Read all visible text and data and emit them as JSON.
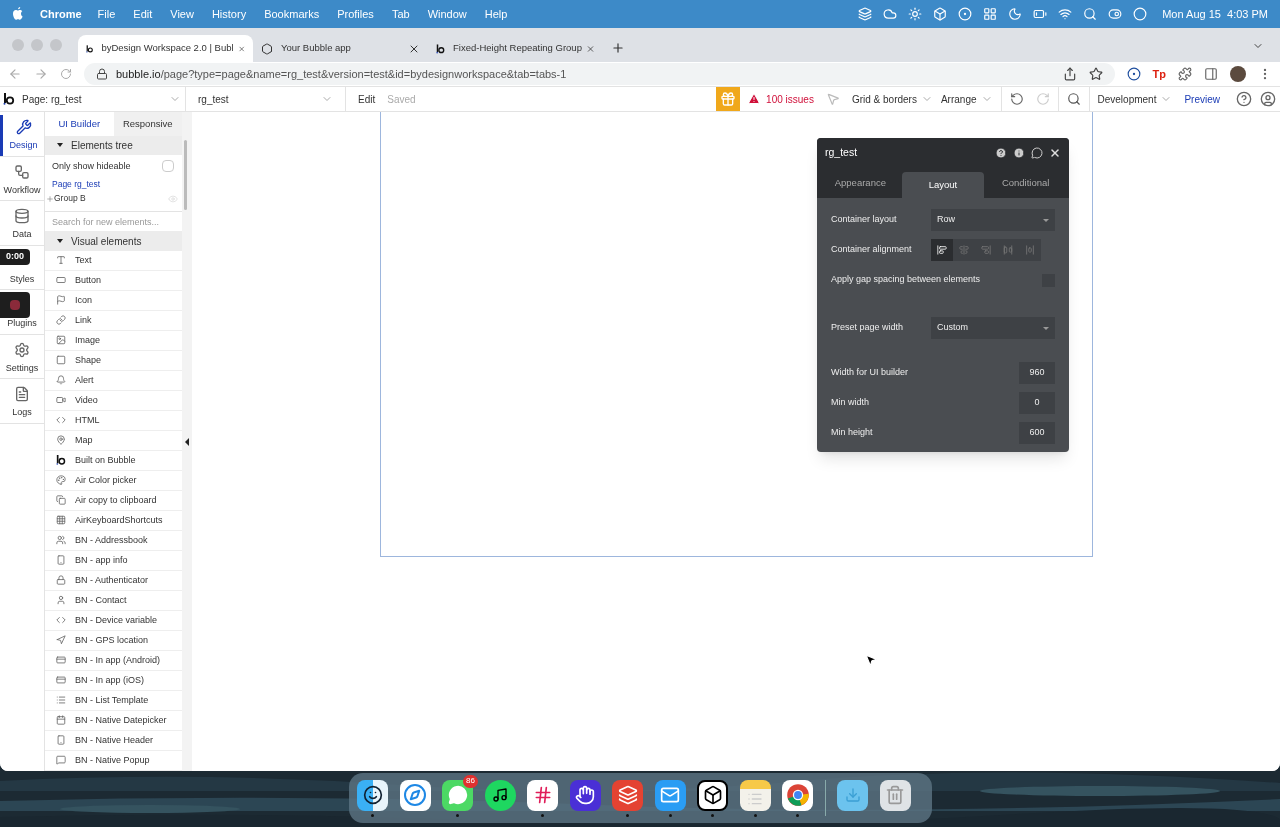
{
  "menu_bar": {
    "app": "Chrome",
    "items": [
      "File",
      "Edit",
      "View",
      "History",
      "Bookmarks",
      "Profiles",
      "Tab",
      "Window",
      "Help"
    ],
    "clock": "Mon Aug 15  4:03 PM"
  },
  "browser": {
    "tabs": [
      {
        "title": "byDesign Workspace 2.0 | Bubl",
        "selected": true
      },
      {
        "title": "Your Bubble app",
        "selected": false
      },
      {
        "title": "Fixed-Height Repeating Group",
        "selected": false
      }
    ],
    "url_host": "bubble.io",
    "url_path": "/page?type=page&name=rg_test&version=test&id=bydesignworkspace&tab=tabs-1",
    "extension_label": "Tp"
  },
  "toolbar": {
    "page_selector": "Page: rg_test",
    "element_selector": "rg_test",
    "edit": "Edit",
    "saved": "Saved",
    "issues": "100 issues",
    "grid": "Grid & borders",
    "arrange": "Arrange",
    "environment": "Development",
    "preview": "Preview"
  },
  "rail": {
    "items": [
      {
        "label": "Design",
        "selected": true
      },
      {
        "label": "Workflow",
        "selected": false
      },
      {
        "label": "Data",
        "selected": false
      },
      {
        "label": "Styles",
        "selected": false
      },
      {
        "label": "Plugins",
        "selected": false
      },
      {
        "label": "Settings",
        "selected": false
      },
      {
        "label": "Logs",
        "selected": false
      }
    ],
    "recording_timer": "0:00"
  },
  "panel": {
    "tabs": [
      {
        "label": "UI Builder",
        "selected": true
      },
      {
        "label": "Responsive",
        "selected": false
      }
    ],
    "tree_header": "Elements tree",
    "only_show_hideable": {
      "label": "Only show hideable",
      "checked": false
    },
    "tree": [
      {
        "label": "Page rg_test",
        "children": [
          {
            "label": "Group B"
          }
        ]
      }
    ],
    "search_placeholder": "Search for new elements...",
    "elements_header": "Visual elements",
    "elements": [
      "Text",
      "Button",
      "Icon",
      "Link",
      "Image",
      "Shape",
      "Alert",
      "Video",
      "HTML",
      "Map",
      "Built on Bubble",
      "Air Color picker",
      "Air copy to clipboard",
      "AirKeyboardShortcuts",
      "BN - Addressbook",
      "BN - app info",
      "BN - Authenticator",
      "BN - Contact",
      "BN - Device variable",
      "BN - GPS location",
      "BN - In app (Android)",
      "BN - In app (iOS)",
      "BN - List Template",
      "BN - Native Datepicker",
      "BN - Native Header",
      "BN - Native Popup"
    ]
  },
  "editor": {
    "title": "rg_test",
    "tabs": [
      {
        "label": "Appearance",
        "selected": false
      },
      {
        "label": "Layout",
        "selected": true
      },
      {
        "label": "Conditional",
        "selected": false
      }
    ],
    "fields": [
      {
        "kind": "dropdown",
        "label": "Container layout",
        "value": "Row"
      },
      {
        "kind": "alignment",
        "label": "Container alignment",
        "options": [
          {
            "selected": true
          },
          {
            "selected": false
          },
          {
            "selected": false
          },
          {
            "selected": false
          },
          {
            "selected": false
          }
        ]
      },
      {
        "kind": "checkbox",
        "label": "Apply gap spacing between elements",
        "checked": false
      },
      {
        "kind": "dropdown",
        "label": "Preset page width",
        "value": "Custom"
      },
      {
        "kind": "number",
        "label": "Width for UI builder",
        "value": "960"
      },
      {
        "kind": "number",
        "label": "Min width",
        "value": "0"
      },
      {
        "kind": "number",
        "label": "Min height",
        "value": "600"
      }
    ]
  },
  "dock": {
    "apps": [
      {
        "running": true
      },
      {
        "running": false
      },
      {
        "running": true,
        "badge": "86"
      },
      {
        "running": false
      },
      {
        "running": true
      },
      {
        "running": false
      },
      {
        "running": true
      },
      {
        "running": true
      },
      {
        "running": true
      },
      {
        "running": true
      },
      {
        "running": true
      },
      {
        "running": false
      },
      {
        "running": false
      }
    ]
  }
}
